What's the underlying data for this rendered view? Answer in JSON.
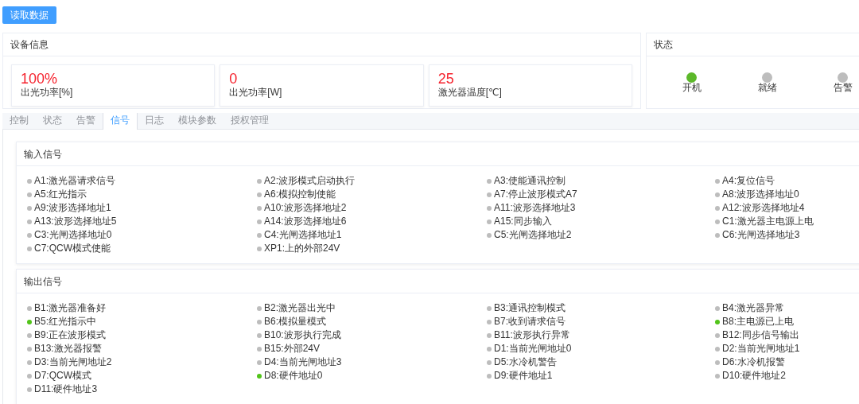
{
  "read_button": "读取数据",
  "device_info": {
    "title": "设备信息",
    "cards": [
      {
        "value": "100%",
        "label": "出光功率[%]"
      },
      {
        "value": "0",
        "label": "出光功率[W]"
      },
      {
        "value": "25",
        "label": "激光器温度[℃]"
      }
    ]
  },
  "status": {
    "title": "状态",
    "lights": [
      {
        "label": "开机",
        "on": true
      },
      {
        "label": "就绪",
        "on": false
      },
      {
        "label": "告警",
        "on": false
      }
    ]
  },
  "tabs": [
    {
      "label": "控制",
      "selected": false
    },
    {
      "label": "状态",
      "selected": false
    },
    {
      "label": "告警",
      "selected": false
    },
    {
      "label": "信号",
      "selected": true
    },
    {
      "label": "日志",
      "selected": false
    },
    {
      "label": "模块参数",
      "selected": false
    },
    {
      "label": "授权管理",
      "selected": false
    }
  ],
  "groups": [
    {
      "title": "输入信号",
      "signals": [
        {
          "label": "A1:激光器请求信号",
          "on": false
        },
        {
          "label": "A2:波形模式启动执行",
          "on": false
        },
        {
          "label": "A3:使能通讯控制",
          "on": false
        },
        {
          "label": "A4:复位信号",
          "on": false
        },
        {
          "label": "A5:红光指示",
          "on": false
        },
        {
          "label": "A6:模拟控制使能",
          "on": false
        },
        {
          "label": "A7:停止波形模式A7",
          "on": false
        },
        {
          "label": "A8:波形选择地址0",
          "on": false
        },
        {
          "label": "A9:波形选择地址1",
          "on": false
        },
        {
          "label": "A10:波形选择地址2",
          "on": false
        },
        {
          "label": "A11:波形选择地址3",
          "on": false
        },
        {
          "label": "A12:波形选择地址4",
          "on": false
        },
        {
          "label": "A13:波形选择地址5",
          "on": false
        },
        {
          "label": "A14:波形选择地址6",
          "on": false
        },
        {
          "label": "A15:同步输入",
          "on": false
        },
        {
          "label": "C1:激光器主电源上电",
          "on": false
        },
        {
          "label": "C3:光闸选择地址0",
          "on": false
        },
        {
          "label": "C4:光闸选择地址1",
          "on": false
        },
        {
          "label": "C5:光闸选择地址2",
          "on": false
        },
        {
          "label": "C6:光闸选择地址3",
          "on": false
        },
        {
          "label": "C7:QCW模式使能",
          "on": false
        },
        {
          "label": "XP1:上的外部24V",
          "on": false
        }
      ]
    },
    {
      "title": "输出信号",
      "signals": [
        {
          "label": "B1:激光器准备好",
          "on": false
        },
        {
          "label": "B2:激光器出光中",
          "on": false
        },
        {
          "label": "B3:通讯控制模式",
          "on": false
        },
        {
          "label": "B4:激光器异常",
          "on": false
        },
        {
          "label": "B5:红光指示中",
          "on": true
        },
        {
          "label": "B6:模拟量模式",
          "on": false
        },
        {
          "label": "B7:收到请求信号",
          "on": false
        },
        {
          "label": "B8:主电源已上电",
          "on": true
        },
        {
          "label": "B9:正在波形模式",
          "on": false
        },
        {
          "label": "B10:波形执行完成",
          "on": false
        },
        {
          "label": "B11:波形执行异常",
          "on": false
        },
        {
          "label": "B12:同步信号输出",
          "on": false
        },
        {
          "label": "B13:激光器报警",
          "on": false
        },
        {
          "label": "B15:外部24V",
          "on": false
        },
        {
          "label": "D1:当前光闸地址0",
          "on": false
        },
        {
          "label": "D2:当前光闸地址1",
          "on": false
        },
        {
          "label": "D3:当前光闸地址2",
          "on": false
        },
        {
          "label": "D4:当前光闸地址3",
          "on": false
        },
        {
          "label": "D5:水冷机警告",
          "on": false
        },
        {
          "label": "D6:水冷机报警",
          "on": false
        },
        {
          "label": "D7:QCW模式",
          "on": false
        },
        {
          "label": "D8:硬件地址0",
          "on": true
        },
        {
          "label": "D9:硬件地址1",
          "on": false
        },
        {
          "label": "D10:硬件地址2",
          "on": false
        },
        {
          "label": "D11:硬件地址3",
          "on": false
        }
      ]
    }
  ]
}
